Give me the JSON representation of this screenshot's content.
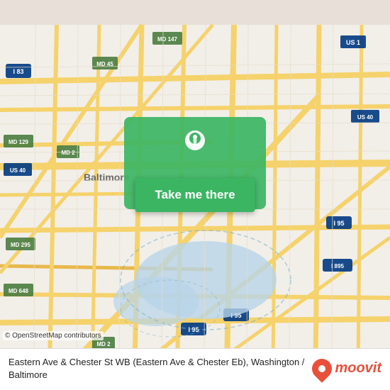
{
  "map": {
    "attribution": "© OpenStreetMap contributors",
    "center_location": "Eastern Ave & Chester St WB"
  },
  "button": {
    "label": "Take me there"
  },
  "info_bar": {
    "location_text": "Eastern Ave & Chester St WB (Eastern Ave & Chester Eb), Washington / Baltimore"
  },
  "moovit": {
    "logo_text": "moovit"
  }
}
